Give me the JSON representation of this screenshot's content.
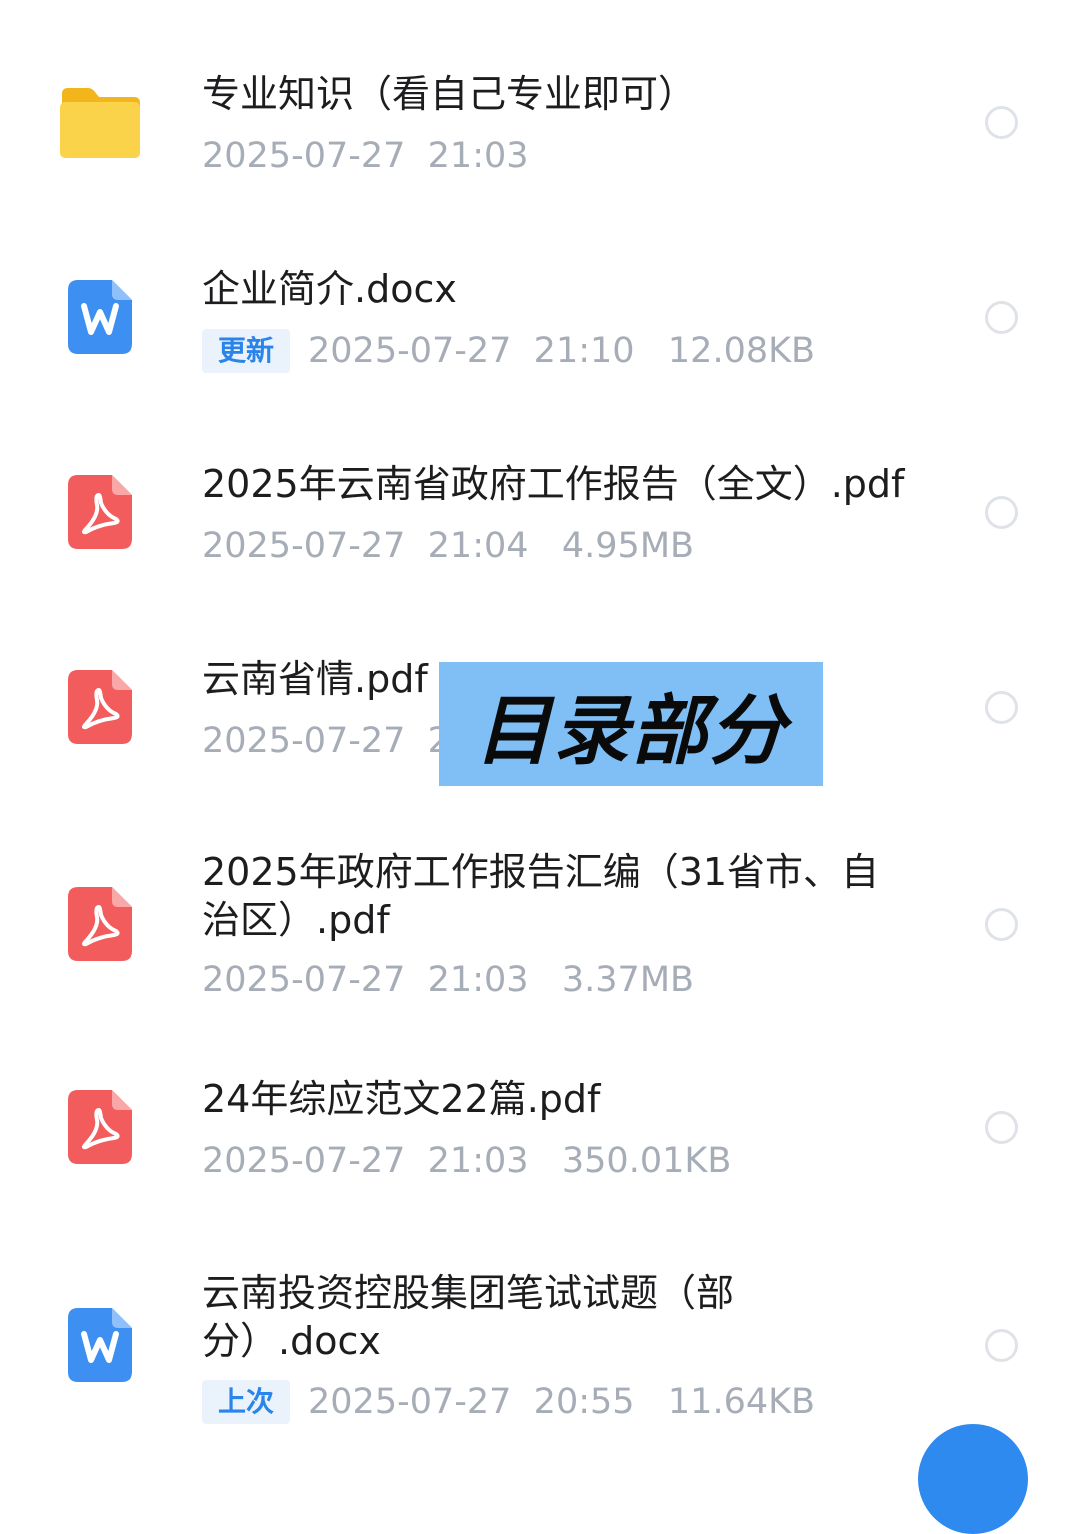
{
  "files": [
    {
      "type": "folder",
      "icon": "folder-icon",
      "title": "专业知识（看自己专业即可）",
      "badge": "",
      "meta": "2025-07-27  21:03"
    },
    {
      "type": "docx",
      "icon": "word-doc-icon",
      "title": "企业简介.docx",
      "badge": "更新",
      "meta": "2025-07-27  21:10   12.08KB"
    },
    {
      "type": "pdf",
      "icon": "pdf-icon",
      "title": "2025年云南省政府工作报告（全文）.pdf",
      "badge": "",
      "meta": "2025-07-27  21:04   4.95MB"
    },
    {
      "type": "pdf",
      "icon": "pdf-icon",
      "title": "云南省情.pdf",
      "badge": "",
      "meta": "2025-07-27  21"
    },
    {
      "type": "pdf",
      "icon": "pdf-icon",
      "title": "2025年政府工作报告汇编（31省市、自\n治区）.pdf",
      "badge": "",
      "meta": "2025-07-27  21:03   3.37MB"
    },
    {
      "type": "pdf",
      "icon": "pdf-icon",
      "title": "24年综应范文22篇.pdf",
      "badge": "",
      "meta": "2025-07-27  21:03   350.01KB"
    },
    {
      "type": "docx",
      "icon": "word-doc-icon",
      "title": "云南投资控股集团笔试试题（部\n分）.docx",
      "badge": "上次",
      "meta": "2025-07-27  20:55   11.64KB"
    }
  ],
  "overlay": {
    "label": "目录部分"
  },
  "colors": {
    "folder": "#f8c93a",
    "word": "#3d8ff2",
    "pdf": "#f25c5c",
    "badge_text": "#2a84ea",
    "badge_bg": "#eaf2fc",
    "meta_text": "#a6adb7",
    "overlay_bg": "#7fbff5"
  }
}
